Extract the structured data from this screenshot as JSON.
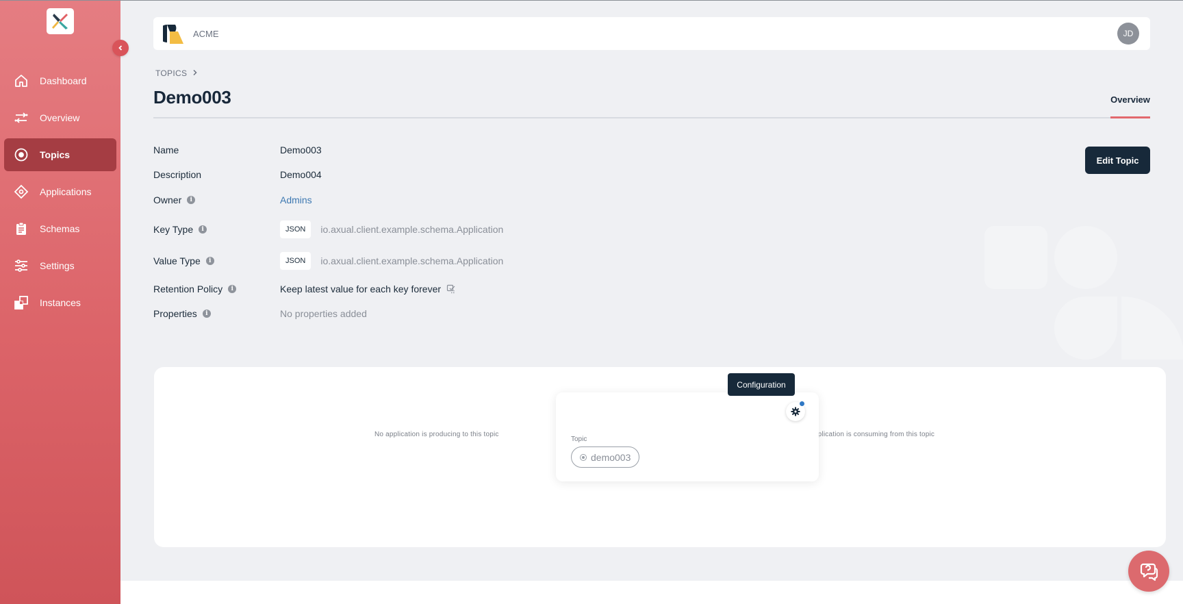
{
  "sidebar": {
    "items": [
      {
        "label": "Dashboard",
        "icon": "home-icon"
      },
      {
        "label": "Overview",
        "icon": "arrows-icon"
      },
      {
        "label": "Topics",
        "icon": "topic-icon",
        "active": true
      },
      {
        "label": "Applications",
        "icon": "diamond-icon"
      },
      {
        "label": "Schemas",
        "icon": "clipboard-icon"
      },
      {
        "label": "Settings",
        "icon": "sliders-icon"
      },
      {
        "label": "Instances",
        "icon": "instances-icon"
      }
    ]
  },
  "header": {
    "org_name": "ACME",
    "avatar_initials": "JD"
  },
  "breadcrumb": {
    "root": "TOPICS"
  },
  "page": {
    "title": "Demo003",
    "tab_overview": "Overview",
    "edit_button": "Edit Topic"
  },
  "details": {
    "name_label": "Name",
    "name_value": "Demo003",
    "description_label": "Description",
    "description_value": "Demo004",
    "owner_label": "Owner",
    "owner_value": "Admins",
    "key_type_label": "Key Type",
    "key_type_badge": "JSON",
    "key_type_schema": "io.axual.client.example.schema.Application",
    "value_type_label": "Value Type",
    "value_type_badge": "JSON",
    "value_type_schema": "io.axual.client.example.schema.Application",
    "retention_label": "Retention Policy",
    "retention_value": "Keep latest value for each key forever",
    "properties_label": "Properties",
    "properties_value": "No properties added"
  },
  "graph": {
    "producers_text": "No application is producing to this topic",
    "consumers_text": "No application is consuming from this topic",
    "topic_label": "Topic",
    "topic_name": "demo003",
    "tooltip": "Configuration"
  },
  "colors": {
    "sidebar_top": "#e57d82",
    "sidebar_bottom": "#cf5459",
    "sidebar_active": "#a53d43",
    "primary_dark": "#17293a",
    "link": "#3d78b1",
    "accent_underline": "#e2686d"
  }
}
